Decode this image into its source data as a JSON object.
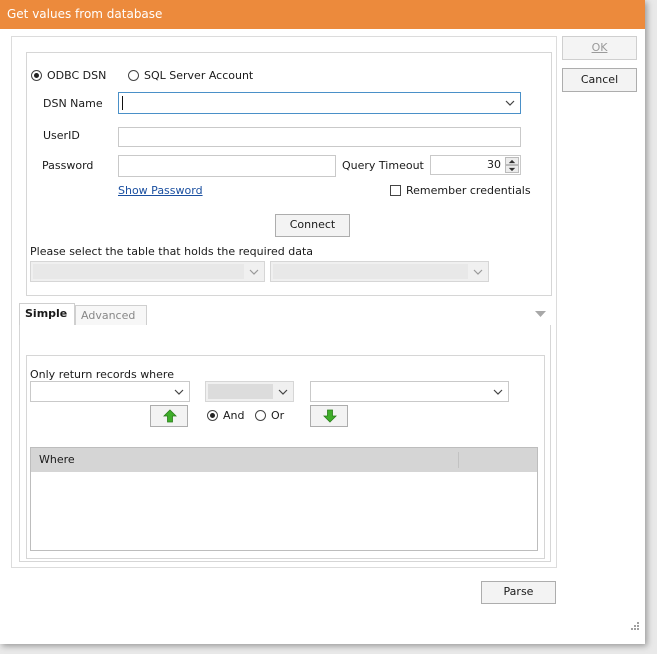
{
  "window": {
    "title": "Get values from database"
  },
  "buttons": {
    "ok": "OK",
    "cancel": "Cancel",
    "connect": "Connect",
    "parse": "Parse"
  },
  "connection": {
    "odbc_label": "ODBC DSN",
    "sql_label": "SQL Server Account",
    "selected": "ODBC DSN",
    "dsn_label": "DSN Name",
    "dsn_value": "",
    "userid_label": "UserID",
    "userid_value": "",
    "password_label": "Password",
    "password_value": "",
    "timeout_label": "Query Timeout",
    "timeout_value": "30",
    "show_password": "Show Password",
    "remember_label": "Remember credentials",
    "table_prompt": "Please select the table that holds the required data"
  },
  "tabs": [
    {
      "label": "Simple",
      "active": true
    },
    {
      "label": "Advanced",
      "active": false
    }
  ],
  "filter": {
    "prompt": "Only return records where",
    "and_label": "And",
    "or_label": "Or",
    "logic_selected": "And",
    "grid_header": "Where"
  },
  "colors": {
    "titlebar": "#ec8a3c",
    "arrow_green": "#3fae2a",
    "link": "#1a4fa0"
  }
}
